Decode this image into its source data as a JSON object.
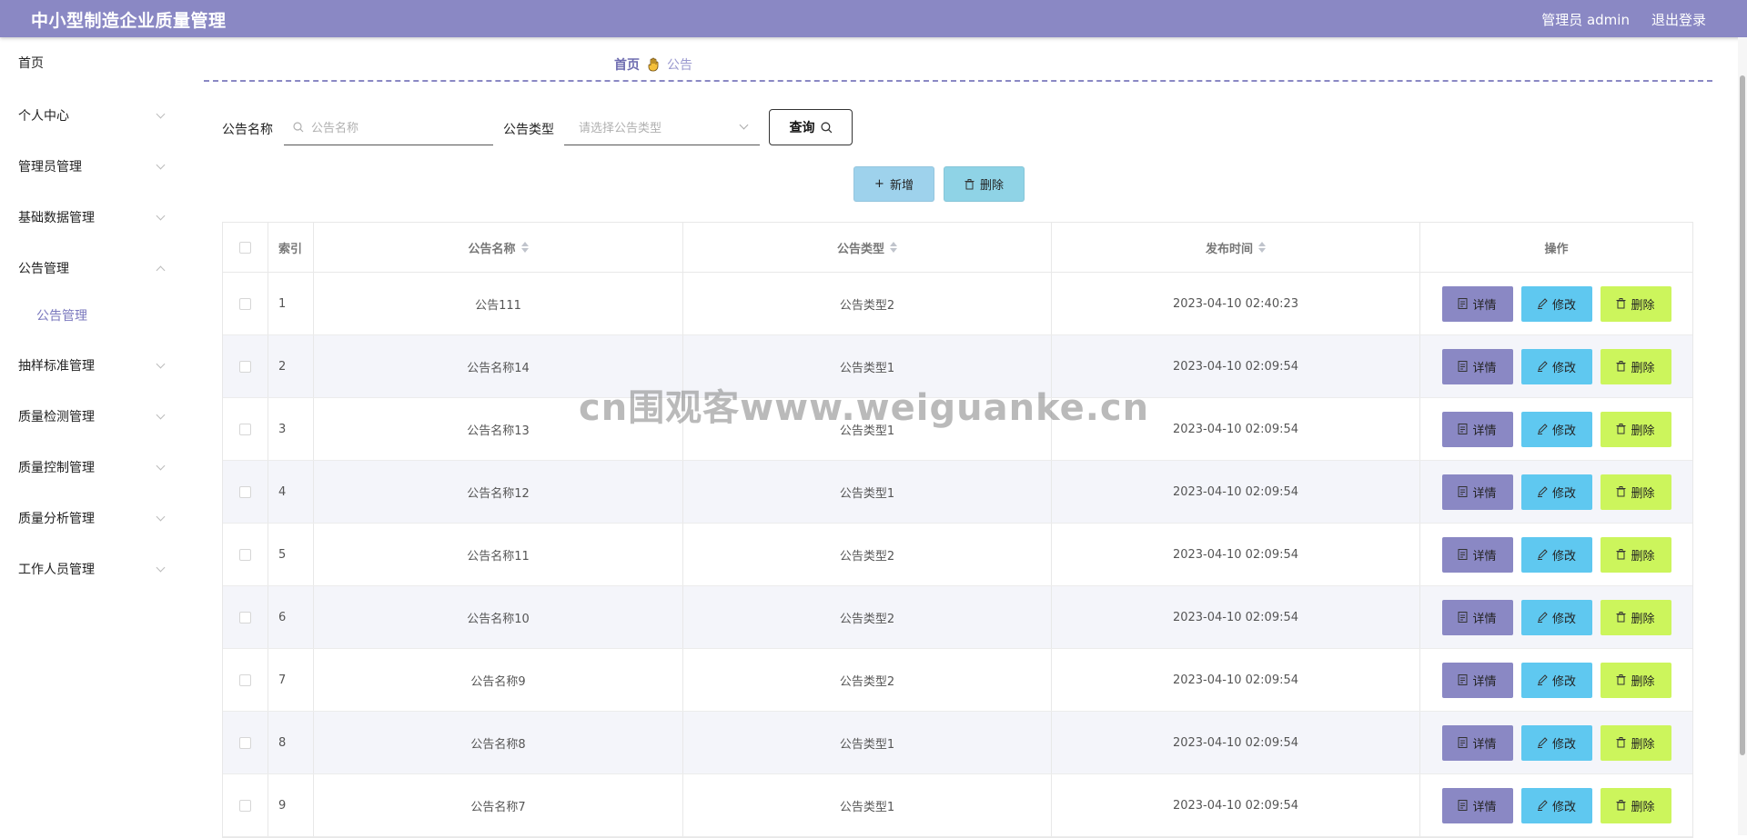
{
  "header": {
    "title": "中小型制造企业质量管理",
    "user_label": "管理员 admin",
    "logout_label": "退出登录",
    "bg_color": "#8a88c4"
  },
  "sidebar": {
    "items": [
      {
        "label": "首页"
      },
      {
        "label": "个人中心"
      },
      {
        "label": "管理员管理"
      },
      {
        "label": "基础数据管理"
      },
      {
        "label": "公告管理"
      },
      {
        "label": "抽样标准管理"
      },
      {
        "label": "质量检测管理"
      },
      {
        "label": "质量控制管理"
      },
      {
        "label": "质量分析管理"
      },
      {
        "label": "工作人员管理"
      }
    ],
    "sub_item": "公告管理"
  },
  "breadcrumb": {
    "home": "首页",
    "current": "公告"
  },
  "search": {
    "name_label": "公告名称",
    "name_placeholder": "公告名称",
    "type_label": "公告类型",
    "type_placeholder": "请选择公告类型",
    "query_label": "查询"
  },
  "actions": {
    "add_label": "新增",
    "delete_label": "删除"
  },
  "table": {
    "headers": {
      "index": "索引",
      "name": "公告名称",
      "type": "公告类型",
      "time": "发布时间",
      "ops": "操作"
    },
    "rows": [
      {
        "index": "1",
        "name": "公告111",
        "type": "公告类型2",
        "time": "2023-04-10 02:40:23"
      },
      {
        "index": "2",
        "name": "公告名称14",
        "type": "公告类型1",
        "time": "2023-04-10 02:09:54"
      },
      {
        "index": "3",
        "name": "公告名称13",
        "type": "公告类型1",
        "time": "2023-04-10 02:09:54"
      },
      {
        "index": "4",
        "name": "公告名称12",
        "type": "公告类型1",
        "time": "2023-04-10 02:09:54"
      },
      {
        "index": "5",
        "name": "公告名称11",
        "type": "公告类型2",
        "time": "2023-04-10 02:09:54"
      },
      {
        "index": "6",
        "name": "公告名称10",
        "type": "公告类型2",
        "time": "2023-04-10 02:09:54"
      },
      {
        "index": "7",
        "name": "公告名称9",
        "type": "公告类型2",
        "time": "2023-04-10 02:09:54"
      },
      {
        "index": "8",
        "name": "公告名称8",
        "type": "公告类型1",
        "time": "2023-04-10 02:09:54"
      },
      {
        "index": "9",
        "name": "公告名称7",
        "type": "公告类型1",
        "time": "2023-04-10 02:09:54"
      }
    ],
    "op_labels": {
      "detail": "详情",
      "edit": "修改",
      "delete": "删除"
    }
  },
  "watermark": "cn围观客www.weiguanke.cn"
}
